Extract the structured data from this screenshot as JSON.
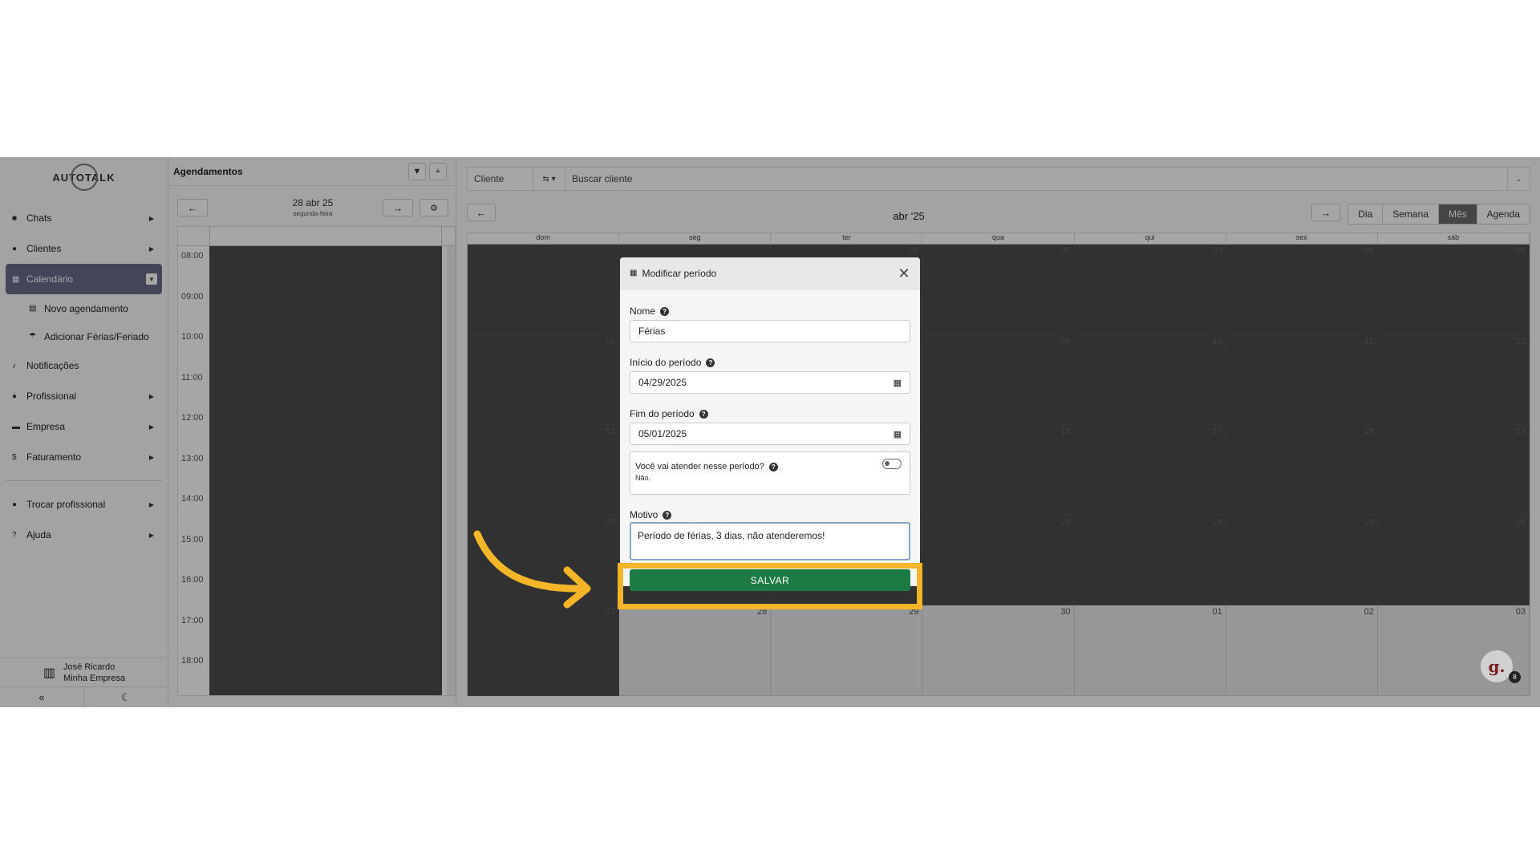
{
  "sidebar": {
    "logo": "AUTOTALK",
    "items": [
      {
        "label": "Chats",
        "icon": "chat-icon"
      },
      {
        "label": "Clientes",
        "icon": "users-icon"
      },
      {
        "label": "Calendário",
        "icon": "calendar-icon"
      },
      {
        "label": "Notificações",
        "icon": "bell-icon"
      },
      {
        "label": "Profissional",
        "icon": "user-tie-icon"
      },
      {
        "label": "Empresa",
        "icon": "building-icon"
      },
      {
        "label": "Faturamento",
        "icon": "dollar-icon"
      },
      {
        "label": "Trocar profissional",
        "icon": "swap-users-icon"
      },
      {
        "label": "Ajuda",
        "icon": "question-icon"
      }
    ],
    "subitems": [
      {
        "label": "Novo agendamento",
        "icon": "calendar-plus-icon"
      },
      {
        "label": "Adicionar Férias/Feriado",
        "icon": "umbrella-beach-icon"
      }
    ],
    "user": {
      "name": "José Ricardo",
      "company": "Minha Empresa"
    }
  },
  "schedule": {
    "title": "Agendamentos",
    "date": "28 abr 25",
    "weekday": "segunda-feira",
    "hours": [
      "08:00",
      "09:00",
      "10:00",
      "11:00",
      "12:00",
      "13:00",
      "14:00",
      "15:00",
      "16:00",
      "17:00",
      "18:00"
    ]
  },
  "calendar": {
    "client_label": "Cliente",
    "search_placeholder": "Buscar cliente",
    "month_title": "abr '25",
    "views": [
      "Dia",
      "Semana",
      "Mês",
      "Agenda"
    ],
    "active_view": "Mês",
    "weekdays": [
      "dom",
      "seg",
      "ter",
      "qua",
      "qui",
      "sex",
      "sáb"
    ],
    "weeks": [
      [
        "",
        "",
        "01",
        "02",
        "03",
        "04",
        "05"
      ],
      [
        "06",
        "",
        "",
        "09",
        "10",
        "11",
        "12"
      ],
      [
        "13",
        "",
        "",
        "16",
        "17",
        "18",
        "19"
      ],
      [
        "20",
        "",
        "",
        "23",
        "24",
        "25",
        "26"
      ],
      [
        "27",
        "28",
        "29",
        "30",
        "01",
        "02",
        "03"
      ]
    ]
  },
  "modal": {
    "title": "Modificar período",
    "name_label": "Nome",
    "name_value": "Férias",
    "start_label": "Início do período",
    "start_value": "04/29/2025",
    "end_label": "Fim do período",
    "end_value": "05/01/2025",
    "attend_question": "Você vai atender nesse período?",
    "attend_answer": "Não.",
    "reason_label": "Motivo",
    "reason_value": "Período de férias, 3 dias, não atenderemos!",
    "save_label": "SALVAR"
  },
  "fab": {
    "letter": "g.",
    "count": "8"
  },
  "colors": {
    "save_button": "#1c7a43",
    "highlight": "#f5b529",
    "active_nav": "#6b6b8a"
  }
}
